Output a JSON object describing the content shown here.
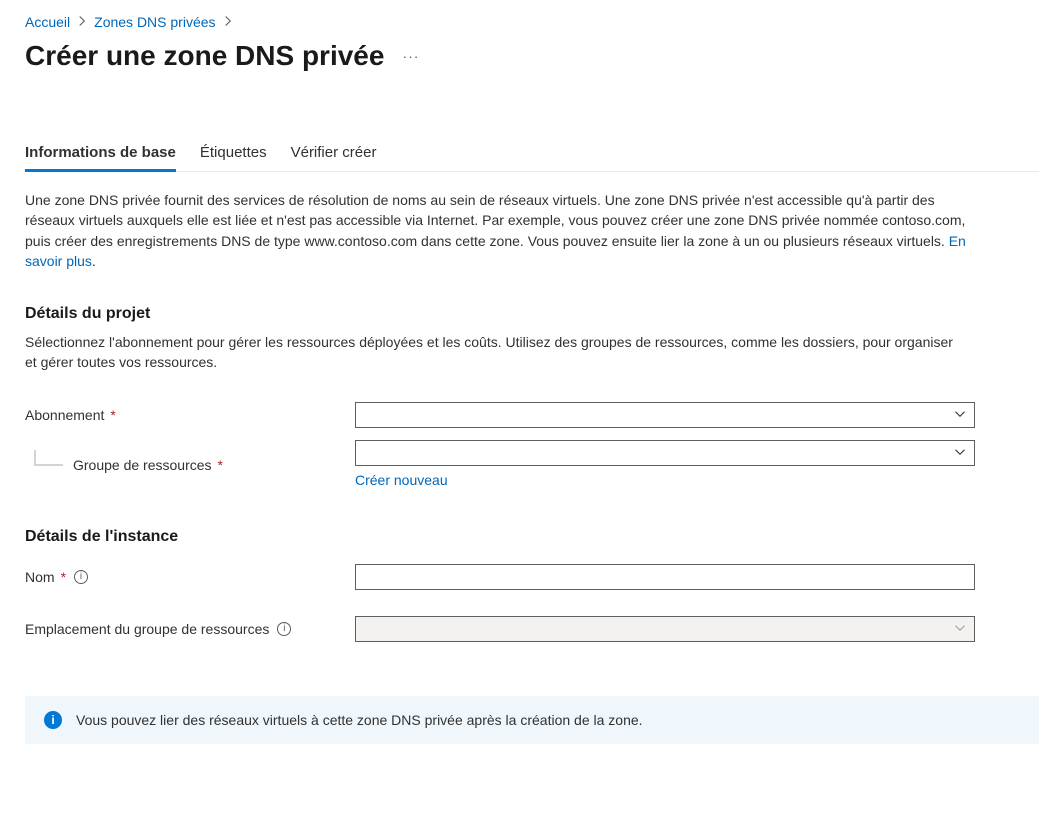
{
  "breadcrumb": {
    "home": "Accueil",
    "zones": "Zones DNS privées"
  },
  "page_title": "Créer une zone DNS privée",
  "tabs": {
    "basics": "Informations de base",
    "tags": "Étiquettes",
    "review": "Vérifier créer"
  },
  "description_text": "Une zone DNS privée fournit des services de résolution de noms au sein de réseaux virtuels. Une zone DNS privée n'est accessible qu'à partir des réseaux virtuels auxquels elle est liée et n'est pas accessible via Internet. Par exemple, vous pouvez créer une zone DNS privée nommée contoso.com, puis créer des enregistrements DNS de type www.contoso.com dans cette zone. Vous pouvez ensuite lier la zone à un ou plusieurs réseaux virtuels. ",
  "learn_more": "En savoir plus",
  "project": {
    "heading": "Détails du projet",
    "desc": "Sélectionnez l'abonnement pour gérer les ressources déployées et les coûts. Utilisez des groupes de ressources, comme les dossiers, pour organiser et gérer toutes vos ressources.",
    "subscription_label": "Abonnement",
    "resource_group_label": "Groupe de ressources",
    "create_new": "Créer nouveau"
  },
  "instance": {
    "heading": "Détails de l'instance",
    "name_label": "Nom",
    "location_label": "Emplacement du groupe de ressources"
  },
  "info_banner": "Vous pouvez lier des réseaux virtuels à cette zone DNS privée après la création de la zone."
}
